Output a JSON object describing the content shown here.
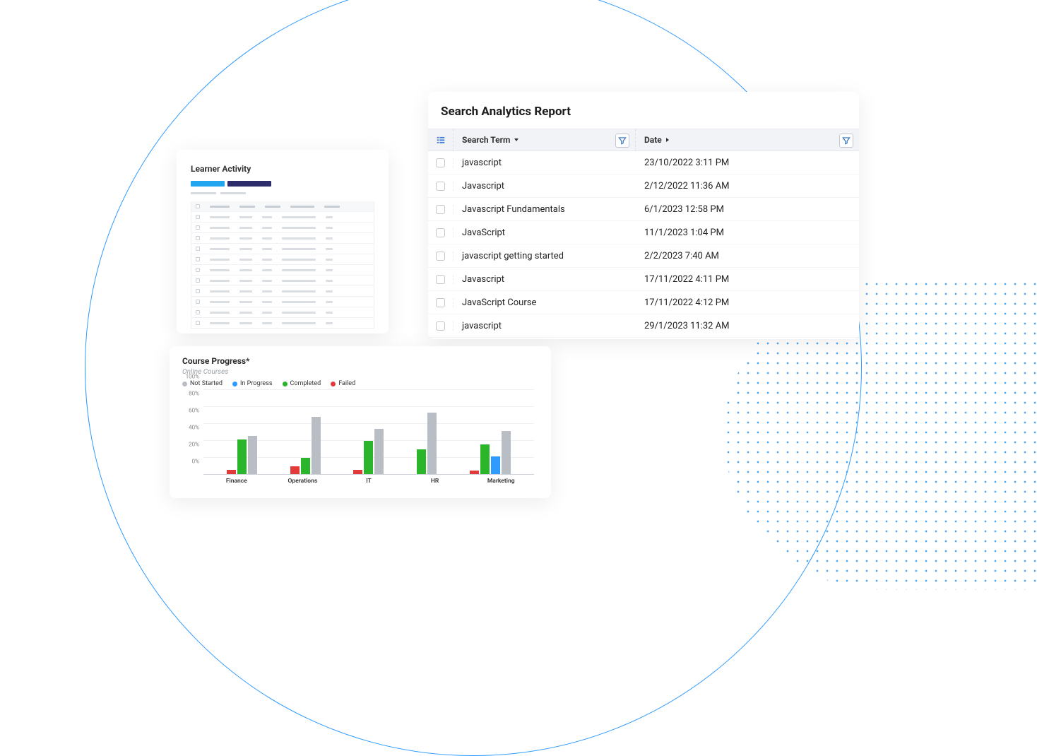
{
  "learner": {
    "title": "Learner Activity"
  },
  "search": {
    "title": "Search Analytics Report",
    "columns": {
      "term": "Search Term",
      "date": "Date"
    },
    "rows": [
      {
        "term": "javascript",
        "date": "23/10/2022 3:11 PM"
      },
      {
        "term": "Javascript",
        "date": "2/12/2022 11:36 AM"
      },
      {
        "term": "Javascript Fundamentals",
        "date": "6/1/2023 12:58 PM"
      },
      {
        "term": "JavaScript",
        "date": "11/1/2023 1:04 PM"
      },
      {
        "term": "javascript getting started",
        "date": "2/2/2023 7:40 AM"
      },
      {
        "term": "Javascript",
        "date": "17/11/2022 4:11 PM"
      },
      {
        "term": "JavaScript Course",
        "date": "17/11/2022 4:12 PM"
      },
      {
        "term": "javascript",
        "date": "29/1/2023 11:32 AM"
      }
    ]
  },
  "course": {
    "title": "Course Progress*",
    "subtitle": "Online Courses",
    "legend": [
      {
        "name": "Not Started",
        "color": "#b9bdc4"
      },
      {
        "name": "In Progress",
        "color": "#2f9bff"
      },
      {
        "name": "Completed",
        "color": "#2bb52b"
      },
      {
        "name": "Failed",
        "color": "#e23a3a"
      }
    ]
  },
  "chart_data": {
    "type": "bar",
    "title": "Course Progress*",
    "subtitle": "Online Courses",
    "ylabel": "",
    "xlabel": "",
    "ylim": [
      0,
      100
    ],
    "yticks": [
      0,
      20,
      40,
      60,
      80,
      100
    ],
    "ytick_labels": [
      "0%",
      "20%",
      "40%",
      "60%",
      "80%",
      "100%"
    ],
    "categories": [
      "Finance",
      "Operations",
      "IT",
      "HR",
      "Marketing"
    ],
    "legend_position": "top-left",
    "series": [
      {
        "name": "Not Started",
        "color": "#b9bdc4",
        "values": [
          46,
          68,
          54,
          73,
          52
        ]
      },
      {
        "name": "In Progress",
        "color": "#2f9bff",
        "values": [
          0,
          0,
          0,
          0,
          22
        ]
      },
      {
        "name": "Completed",
        "color": "#2bb52b",
        "values": [
          42,
          20,
          40,
          30,
          36
        ]
      },
      {
        "name": "Failed",
        "color": "#e23a3a",
        "values": [
          6,
          10,
          6,
          0,
          5
        ]
      }
    ]
  }
}
